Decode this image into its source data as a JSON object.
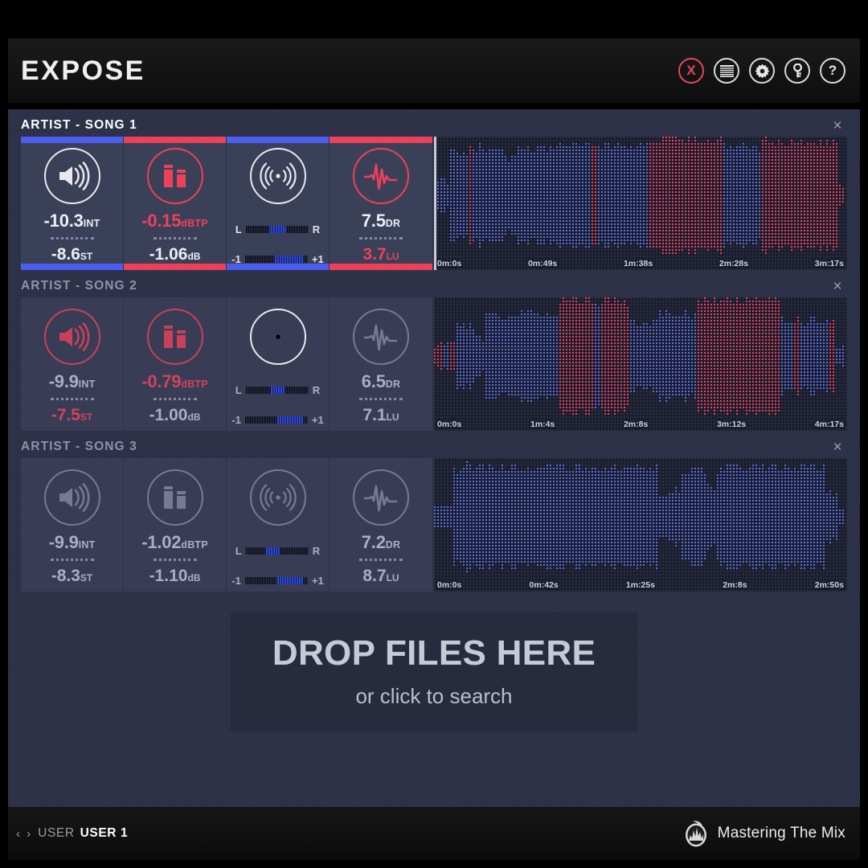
{
  "app": {
    "title": "EXPOSE",
    "title_icons": [
      {
        "name": "close-icon",
        "glyph": "X",
        "color": "#e4465c"
      },
      {
        "name": "list-icon",
        "glyph": "list"
      },
      {
        "name": "gear-icon",
        "glyph": "gear"
      },
      {
        "name": "key-icon",
        "glyph": "key"
      },
      {
        "name": "help-icon",
        "glyph": "?"
      }
    ]
  },
  "colors": {
    "accent_red": "#ed4159",
    "accent_blue": "#4c5ef0",
    "wave_blue": "#5b6fe0",
    "wave_red": "#ee3f57",
    "panel_bg": "#2d3148",
    "card_bg": "#3b4059",
    "wave_bg": "#15192a",
    "text_primary": "#edeef2",
    "text_dim": "#8d93ad"
  },
  "dropzone": {
    "main": "DROP FILES HERE",
    "sub": "or click to search"
  },
  "footer": {
    "arrows": "‹ ›",
    "user_label": "USER",
    "user_name": "USER 1",
    "brand": "Mastering The Mix"
  },
  "songs": [
    {
      "title": "ARTIST - SONG 1",
      "active": true,
      "close": "×",
      "cards": [
        {
          "icon": "loudness-icon",
          "accent": "#4c5ef0",
          "icon_color": "#e9e9ec",
          "main_value": "-10.3",
          "main_unit": "INT",
          "main_color": "#edeef2",
          "sub_value": "-8.6",
          "sub_unit": "ST",
          "sub_color": "#edeef2"
        },
        {
          "icon": "peak-icon",
          "accent": "#ed4159",
          "icon_color": "#ed4159",
          "main_value": "-0.15",
          "main_unit": "dBTP",
          "main_color": "#ed4159",
          "sub_value": "-1.06",
          "sub_unit": "dB",
          "sub_color": "#edeef2"
        },
        {
          "icon": "stereo-icon",
          "accent": "#4c5ef0",
          "icon_color": "#e9e9ec",
          "meter": true,
          "meter_top": {
            "left_label": "L",
            "right_label": "R",
            "fill_start": 38,
            "fill_width": 26
          },
          "meter_bottom": {
            "left_label": "-1",
            "right_label": "+1",
            "fill_start": 46,
            "fill_width": 48
          }
        },
        {
          "icon": "dynamics-icon",
          "accent": "#ed4159",
          "icon_color": "#ed4159",
          "main_value": "7.5",
          "main_unit": "DR",
          "main_color": "#edeef2",
          "sub_value": "3.7",
          "sub_unit": "LU",
          "sub_color": "#ed4159"
        }
      ],
      "wave": {
        "times": [
          "0m:0s",
          "0m:49s",
          "1m:38s",
          "2m:28s",
          "3m:17s"
        ],
        "segments": [
          {
            "start": 0.0,
            "end": 0.035,
            "amp": 0.2,
            "color": "blue"
          },
          {
            "start": 0.035,
            "end": 0.08,
            "amp": 0.72,
            "color": "blue"
          },
          {
            "start": 0.08,
            "end": 0.09,
            "amp": 0.92,
            "color": "red"
          },
          {
            "start": 0.09,
            "end": 0.17,
            "amp": 0.8,
            "color": "blue"
          },
          {
            "start": 0.17,
            "end": 0.2,
            "amp": 0.62,
            "color": "blue"
          },
          {
            "start": 0.2,
            "end": 0.28,
            "amp": 0.78,
            "color": "blue"
          },
          {
            "start": 0.28,
            "end": 0.38,
            "amp": 0.86,
            "color": "blue"
          },
          {
            "start": 0.38,
            "end": 0.392,
            "amp": 0.88,
            "color": "red"
          },
          {
            "start": 0.392,
            "end": 0.52,
            "amp": 0.84,
            "color": "blue"
          },
          {
            "start": 0.52,
            "end": 0.7,
            "amp": 0.94,
            "color": "red"
          },
          {
            "start": 0.7,
            "end": 0.79,
            "amp": 0.8,
            "color": "blue"
          },
          {
            "start": 0.79,
            "end": 0.98,
            "amp": 0.9,
            "color": "red"
          },
          {
            "start": 0.98,
            "end": 1.0,
            "amp": 0.12,
            "color": "red"
          }
        ]
      }
    },
    {
      "title": "ARTIST - SONG 2",
      "active": false,
      "close": "×",
      "cards": [
        {
          "icon": "loudness-icon",
          "accent": null,
          "icon_color": "#c8405a",
          "main_value": "-9.9",
          "main_unit": "INT",
          "main_color": "#a9aec4",
          "sub_value": "-7.5",
          "sub_unit": "ST",
          "sub_color": "#d1425c"
        },
        {
          "icon": "peak-icon",
          "accent": null,
          "icon_color": "#c8405a",
          "main_value": "-0.79",
          "main_unit": "dBTP",
          "main_color": "#d1425c",
          "sub_value": "-1.00",
          "sub_unit": "dB",
          "sub_color": "#a9aec4"
        },
        {
          "icon": "stereo-icon",
          "accent": null,
          "icon_color": "#6e7characters",
          "meter": true,
          "meter_top": {
            "left_label": "L",
            "right_label": "R",
            "fill_start": 40,
            "fill_width": 22
          },
          "meter_bottom": {
            "left_label": "-1",
            "right_label": "+1",
            "fill_start": 52,
            "fill_width": 40
          }
        },
        {
          "icon": "dynamics-icon",
          "accent": null,
          "icon_color": "#757b96",
          "main_value": "6.5",
          "main_unit": "DR",
          "main_color": "#a9aec4",
          "sub_value": "7.1",
          "sub_unit": "LU",
          "sub_color": "#a9aec4"
        }
      ],
      "wave": {
        "times": [
          "0m:0s",
          "1m:4s",
          "2m:8s",
          "3m:12s",
          "4m:17s"
        ],
        "segments": [
          {
            "start": 0.0,
            "end": 0.018,
            "amp": 0.18,
            "color": "red"
          },
          {
            "start": 0.018,
            "end": 0.035,
            "amp": 0.22,
            "color": "blue"
          },
          {
            "start": 0.035,
            "end": 0.048,
            "amp": 0.2,
            "color": "red"
          },
          {
            "start": 0.048,
            "end": 0.1,
            "amp": 0.52,
            "color": "blue"
          },
          {
            "start": 0.1,
            "end": 0.12,
            "amp": 0.3,
            "color": "blue"
          },
          {
            "start": 0.12,
            "end": 0.28,
            "amp": 0.7,
            "color": "blue"
          },
          {
            "start": 0.28,
            "end": 0.3,
            "amp": 0.6,
            "color": "blue"
          },
          {
            "start": 0.3,
            "end": 0.39,
            "amp": 0.92,
            "color": "red"
          },
          {
            "start": 0.39,
            "end": 0.405,
            "amp": 0.9,
            "color": "blue"
          },
          {
            "start": 0.405,
            "end": 0.475,
            "amp": 0.92,
            "color": "red"
          },
          {
            "start": 0.475,
            "end": 0.54,
            "amp": 0.56,
            "color": "blue"
          },
          {
            "start": 0.54,
            "end": 0.64,
            "amp": 0.7,
            "color": "blue"
          },
          {
            "start": 0.64,
            "end": 0.84,
            "amp": 0.94,
            "color": "red"
          },
          {
            "start": 0.84,
            "end": 0.87,
            "amp": 0.6,
            "color": "blue"
          },
          {
            "start": 0.87,
            "end": 0.885,
            "amp": 0.62,
            "color": "red"
          },
          {
            "start": 0.885,
            "end": 0.955,
            "amp": 0.58,
            "color": "blue"
          },
          {
            "start": 0.955,
            "end": 0.975,
            "amp": 0.64,
            "color": "red"
          },
          {
            "start": 0.975,
            "end": 1.0,
            "amp": 0.16,
            "color": "blue"
          }
        ]
      }
    },
    {
      "title": "ARTIST - SONG 3",
      "active": false,
      "close": "×",
      "cards": [
        {
          "icon": "loudness-icon",
          "accent": null,
          "icon_color": "#757b96",
          "main_value": "-9.9",
          "main_unit": "INT",
          "main_color": "#a9aec4",
          "sub_value": "-8.3",
          "sub_unit": "ST",
          "sub_color": "#a9aec4"
        },
        {
          "icon": "peak-icon",
          "accent": null,
          "icon_color": "#757b96",
          "main_value": "-1.02",
          "main_unit": "dBTP",
          "main_color": "#a9aec4",
          "sub_value": "-1.10",
          "sub_unit": "dB",
          "sub_color": "#a9aec4"
        },
        {
          "icon": "stereo-icon",
          "accent": null,
          "icon_color": "#757b96",
          "meter": true,
          "meter_top": {
            "left_label": "L",
            "right_label": "R",
            "fill_start": 32,
            "fill_width": 22
          },
          "meter_bottom": {
            "left_label": "-1",
            "right_label": "+1",
            "fill_start": 50,
            "fill_width": 42
          }
        },
        {
          "icon": "dynamics-icon",
          "accent": null,
          "icon_color": "#757b96",
          "main_value": "7.2",
          "main_unit": "DR",
          "main_color": "#a9aec4",
          "sub_value": "8.7",
          "sub_unit": "LU",
          "sub_color": "#a9aec4"
        }
      ],
      "wave": {
        "times": [
          "0m:0s",
          "0m:42s",
          "1m:25s",
          "2m:8s",
          "2m:50s"
        ],
        "segments": [
          {
            "start": 0.0,
            "end": 0.04,
            "amp": 0.2,
            "color": "blue"
          },
          {
            "start": 0.04,
            "end": 0.075,
            "amp": 0.78,
            "color": "blue"
          },
          {
            "start": 0.075,
            "end": 0.3,
            "amp": 0.84,
            "color": "blue"
          },
          {
            "start": 0.3,
            "end": 0.5,
            "amp": 0.82,
            "color": "blue"
          },
          {
            "start": 0.5,
            "end": 0.545,
            "amp": 0.8,
            "color": "blue"
          },
          {
            "start": 0.545,
            "end": 0.565,
            "amp": 0.36,
            "color": "blue"
          },
          {
            "start": 0.565,
            "end": 0.6,
            "amp": 0.46,
            "color": "blue"
          },
          {
            "start": 0.6,
            "end": 0.66,
            "amp": 0.76,
            "color": "blue"
          },
          {
            "start": 0.66,
            "end": 0.685,
            "amp": 0.52,
            "color": "blue"
          },
          {
            "start": 0.685,
            "end": 0.95,
            "amp": 0.82,
            "color": "blue"
          },
          {
            "start": 0.95,
            "end": 0.98,
            "amp": 0.4,
            "color": "blue"
          },
          {
            "start": 0.98,
            "end": 1.0,
            "amp": 0.1,
            "color": "blue"
          }
        ]
      }
    }
  ]
}
